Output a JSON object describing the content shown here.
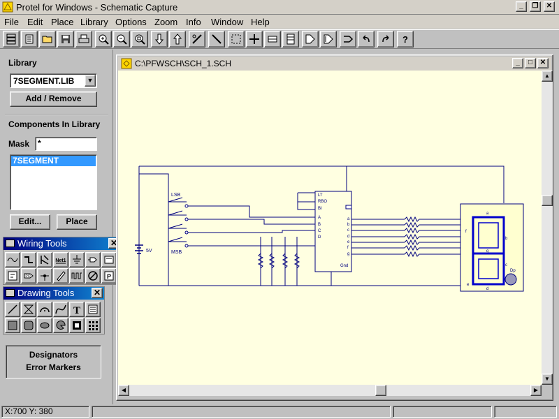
{
  "window": {
    "title": "Protel for Windows - Schematic Capture"
  },
  "menu": [
    "File",
    "Edit",
    "Place",
    "Library",
    "Options",
    "Zoom",
    "Info",
    "Window",
    "Help"
  ],
  "toolbar": {
    "icons": [
      "hierarchy-icon",
      "open-folder-icon",
      "open-icon",
      "save-icon",
      "print-icon",
      "zoom-in-icon",
      "zoom-out-icon",
      "zoom-area-icon",
      "move-down-icon",
      "move-up-icon",
      "cut-wire-icon",
      "draw-line-icon",
      "select-area-icon",
      "move-icon",
      "bus-icon",
      "sheet-icon",
      "part-icon",
      "part-edit-icon",
      "net-icon",
      "undo-icon",
      "redo-icon",
      "help-icon"
    ]
  },
  "library": {
    "label": "Library",
    "selected": "7SEGMENT.LIB",
    "add_remove": "Add / Remove",
    "components_label": "Components In Library",
    "mask_label": "Mask",
    "mask_value": "*",
    "components": [
      "7SEGMENT"
    ],
    "edit_button": "Edit...",
    "place_button": "Place"
  },
  "wiring_tools": {
    "title": "Wiring Tools"
  },
  "drawing_tools": {
    "title": "Drawing Tools"
  },
  "display": {
    "designators": "Designators",
    "error_markers": "Error Markers"
  },
  "document": {
    "title": "C:\\PFWSCH\\SCH_1.SCH"
  },
  "schematic": {
    "switch_top": "LSB",
    "switch_bottom": "MSB",
    "battery": "5V",
    "ic_left_pins": [
      "LT",
      "RBO",
      "BI",
      "A",
      "B",
      "C",
      "D"
    ],
    "ic_right_pins": [
      "a",
      "b",
      "c",
      "d",
      "e",
      "f",
      "g"
    ],
    "ic_gnd": "Gnd",
    "display_seg_f": "f",
    "display_seg_b": "b",
    "display_seg_c": "c",
    "display_seg_e": "e",
    "display_seg_a": "a",
    "display_seg_d": "d",
    "display_seg_g": "g",
    "display_dp": "Dp"
  },
  "status": {
    "coords": "X:700 Y: 380"
  }
}
